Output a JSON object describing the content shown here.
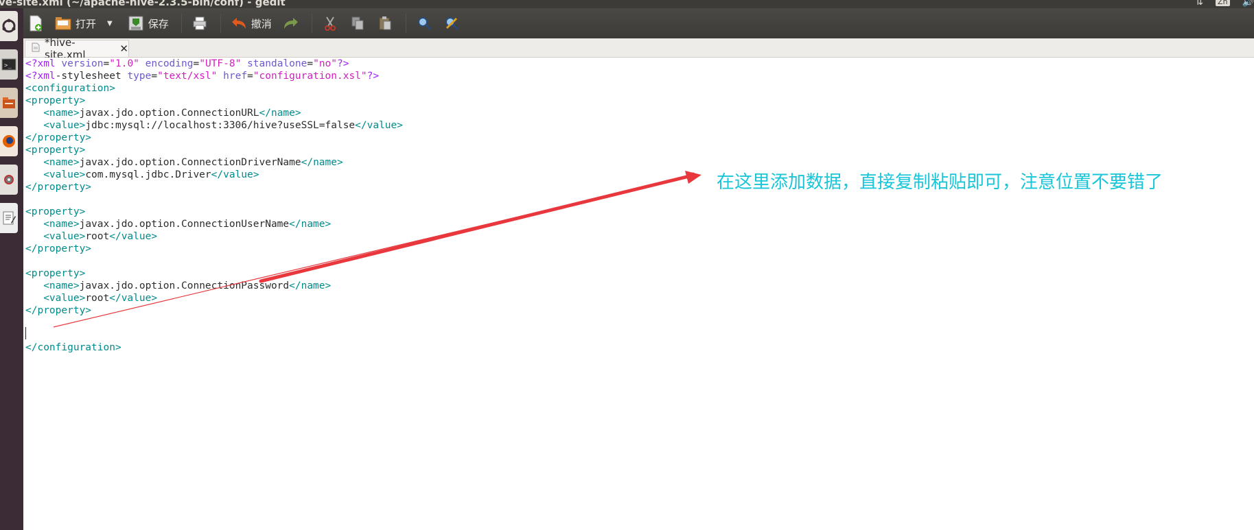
{
  "window": {
    "title": "ve-site.xml (~/apache-hive-2.3.5-bin/conf) - gedit",
    "tray": {
      "ime": "Zh"
    }
  },
  "toolbar": {
    "open_label": "打开",
    "save_label": "保存",
    "undo_label": "撤消"
  },
  "tab": {
    "label": "*hive-site.xml",
    "close": "✕"
  },
  "editor": {
    "lines": [
      "<?xml version=\"1.0\" encoding=\"UTF-8\" standalone=\"no\"?>",
      "<?xml-stylesheet type=\"text/xsl\" href=\"configuration.xsl\"?>",
      "<configuration>",
      "<property>",
      "   <name>javax.jdo.option.ConnectionURL</name>",
      "   <value>jdbc:mysql://localhost:3306/hive?useSSL=false</value>",
      "</property>",
      "<property>",
      "   <name>javax.jdo.option.ConnectionDriverName</name>",
      "   <value>com.mysql.jdbc.Driver</value>",
      "</property>",
      "",
      "<property>",
      "   <name>javax.jdo.option.ConnectionUserName</name>",
      "   <value>root</value>",
      "</property>",
      "",
      "<property>",
      "   <name>javax.jdo.option.ConnectionPassword</name>",
      "   <value>root</value>",
      "</property>",
      "",
      "",
      "</configuration>"
    ]
  },
  "annotation": {
    "text": "在这里添加数据，直接复制粘贴即可，注意位置不要错了",
    "color": "#19c5d8",
    "arrow_color": "#e8383d"
  }
}
